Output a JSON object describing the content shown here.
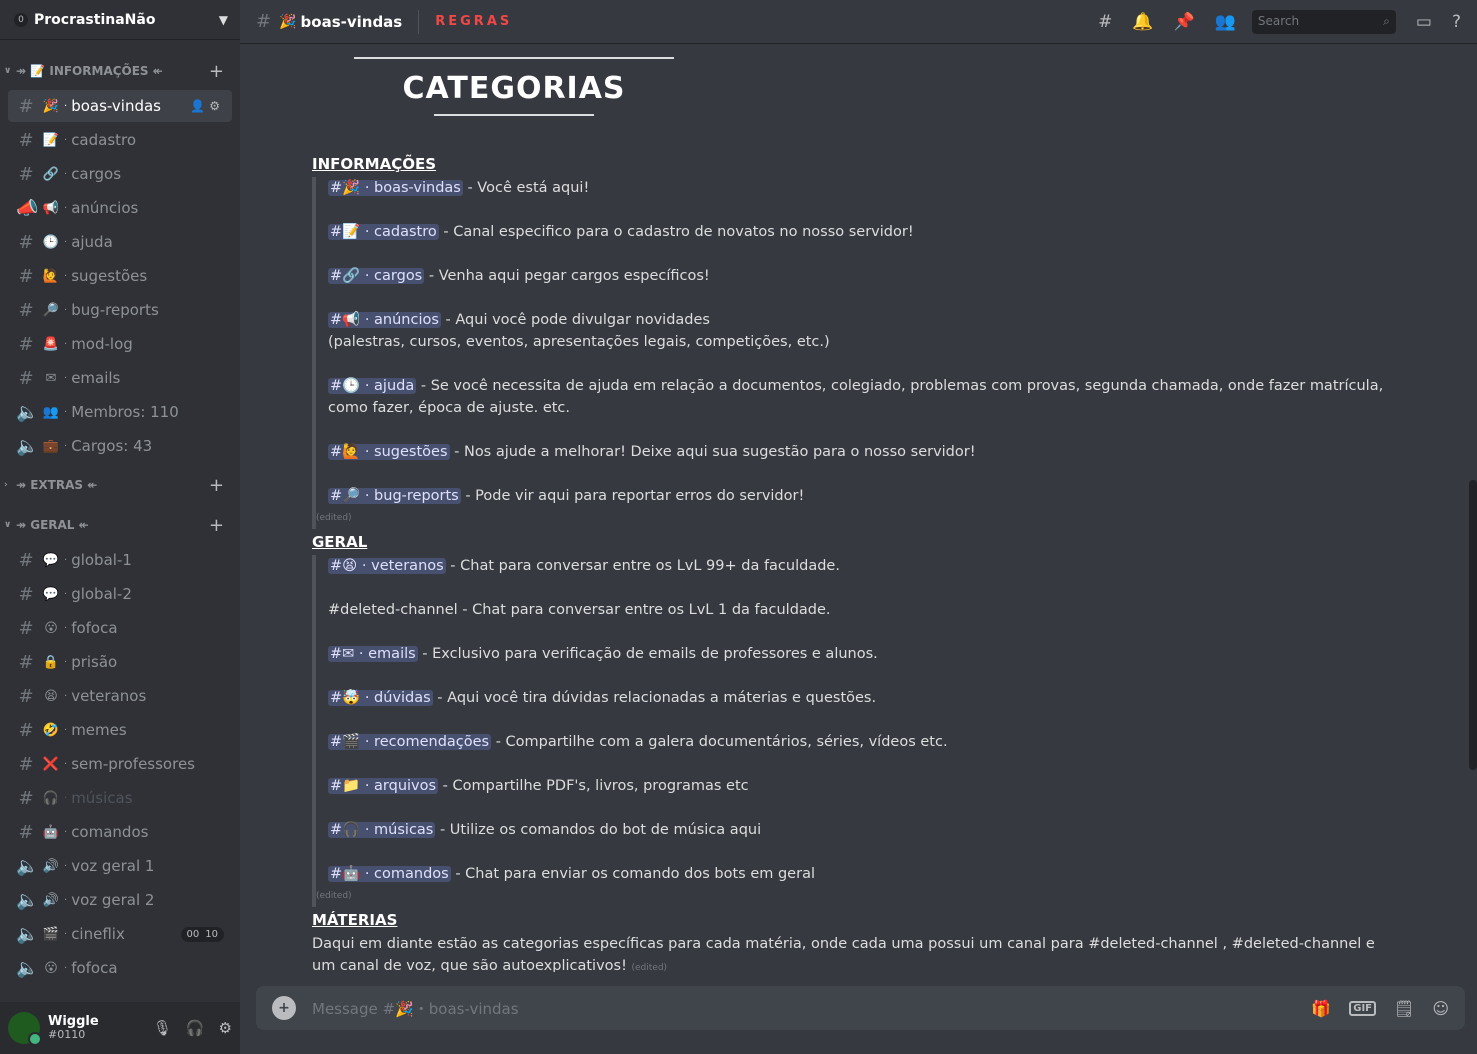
{
  "server": {
    "badge": "0",
    "name": "ProcrastinaNão"
  },
  "categories": {
    "info": {
      "label": "↠ 📝 INFORMAÇÕES ↞"
    },
    "extras": {
      "label": "↠ EXTRAS ↞"
    },
    "geral": {
      "label": "↠ GERAL ↞"
    }
  },
  "info_channels": [
    {
      "emoji": "🎉",
      "name": "boas-vindas",
      "type": "text"
    },
    {
      "emoji": "📝",
      "name": "cadastro",
      "type": "text"
    },
    {
      "emoji": "🔗",
      "name": "cargos",
      "type": "text"
    },
    {
      "emoji": "📢",
      "name": "anúncios",
      "type": "news"
    },
    {
      "emoji": "🕒",
      "name": "ajuda",
      "type": "text"
    },
    {
      "emoji": "🙋",
      "name": "sugestões",
      "type": "text"
    },
    {
      "emoji": "🔎",
      "name": "bug-reports",
      "type": "text"
    },
    {
      "emoji": "🚨",
      "name": "mod-log",
      "type": "text"
    },
    {
      "emoji": "✉",
      "name": "emails",
      "type": "text"
    },
    {
      "emoji": "👥",
      "name": "Membros: 110",
      "type": "voice"
    },
    {
      "emoji": "💼",
      "name": "Cargos: 43",
      "type": "voice"
    }
  ],
  "geral_channels": [
    {
      "emoji": "💬",
      "name": "global-1",
      "type": "text"
    },
    {
      "emoji": "💬",
      "name": "global-2",
      "type": "text"
    },
    {
      "emoji": "😮",
      "name": "fofoca",
      "type": "text"
    },
    {
      "emoji": "🔒",
      "name": "prisão",
      "type": "text"
    },
    {
      "emoji": "😫",
      "name": "veteranos",
      "type": "text"
    },
    {
      "emoji": "🤣",
      "name": "memes",
      "type": "text"
    },
    {
      "emoji": "❌",
      "name": "sem-professores",
      "type": "text"
    },
    {
      "emoji": "🎧",
      "name": "músicas",
      "type": "text"
    },
    {
      "emoji": "🤖",
      "name": "comandos",
      "type": "text"
    },
    {
      "emoji": "🔊",
      "name": "voz geral 1",
      "type": "voice"
    },
    {
      "emoji": "🔊",
      "name": "voz geral 2",
      "type": "voice"
    },
    {
      "emoji": "🎬",
      "name": "cineflix",
      "type": "voice",
      "count_a": "00",
      "count_b": "10"
    },
    {
      "emoji": "😮",
      "name": "fofoca",
      "type": "voice"
    }
  ],
  "user": {
    "name": "Wiggle",
    "tag": "#0110"
  },
  "topbar": {
    "channel": "boas-vindas",
    "emoji": "🎉",
    "topic": "REGRAS",
    "search_placeholder": "Search"
  },
  "banner": {
    "title": "CATEGORIAS"
  },
  "sections": {
    "info": "INFORMAÇÕES",
    "geral": "GERAL",
    "materias": "MÁTERIAS"
  },
  "info_rows": [
    {
      "emoji": "🎉",
      "name": "boas-vindas",
      "desc": " - Você está aqui!"
    },
    {
      "emoji": "📝",
      "name": "cadastro",
      "desc": "  - Canal especifico para o cadastro de novatos no nosso servidor!"
    },
    {
      "emoji": "🔗",
      "name": "cargos",
      "desc": " - Venha aqui pegar cargos específicos!"
    },
    {
      "emoji": "📢",
      "name": "anúncios",
      "desc": " - Aqui você pode divulgar novidades",
      "desc2": "(palestras, cursos, eventos, apresentações legais, competições, etc.)"
    },
    {
      "emoji": "🕒",
      "name": "ajuda",
      "desc": " - Se você necessita de ajuda em relação a documentos, colegiado, problemas com provas, segunda chamada, onde fazer matrícula,",
      "desc2": "como fazer, época de ajuste. etc."
    },
    {
      "emoji": "🙋",
      "name": "sugestões",
      "desc": " - Nos ajude a melhorar! Deixe aqui sua sugestão para o nosso servidor!"
    },
    {
      "emoji": "🔎",
      "name": "bug-reports",
      "desc": " - Pode vir aqui para reportar erros do servidor!"
    }
  ],
  "geral_rows": [
    {
      "emoji": "😫",
      "name": "veteranos",
      "desc": " - Chat para conversar entre os LvL 99+ da faculdade."
    },
    {
      "plain": "#deleted-channel - Chat para conversar entre os LvL 1 da faculdade."
    },
    {
      "emoji": "✉",
      "name": "emails",
      "desc": " - Exclusivo para verificação de emails de professores e alunos."
    },
    {
      "emoji": "🤯",
      "name": "dúvidas",
      "desc": " - Aqui você tira dúvidas relacionadas a máterias e questões."
    },
    {
      "emoji": "🎬",
      "name": "recomendações",
      "desc": " - Compartilhe com a galera documentários, séries, vídeos etc."
    },
    {
      "emoji": "📁",
      "name": "arquivos",
      "desc": " - Compartilhe PDF's, livros, programas etc"
    },
    {
      "emoji": "🎧",
      "name": "músicas",
      "desc": " - Utilize os comandos do bot de música aqui"
    },
    {
      "emoji": "🤖",
      "name": "comandos",
      "desc": " - Chat para enviar os comando dos bots em geral"
    }
  ],
  "edited": "(edited)",
  "materias_text": "Daqui em diante estão as categorias específicas para cada matéria, onde cada uma possui um canal para #deleted-channel , #deleted-channel   e um canal de voz, que são autoexplicativos!",
  "composer": {
    "placeholder": "Message #🎉・boas-vindas",
    "gif": "GIF"
  }
}
